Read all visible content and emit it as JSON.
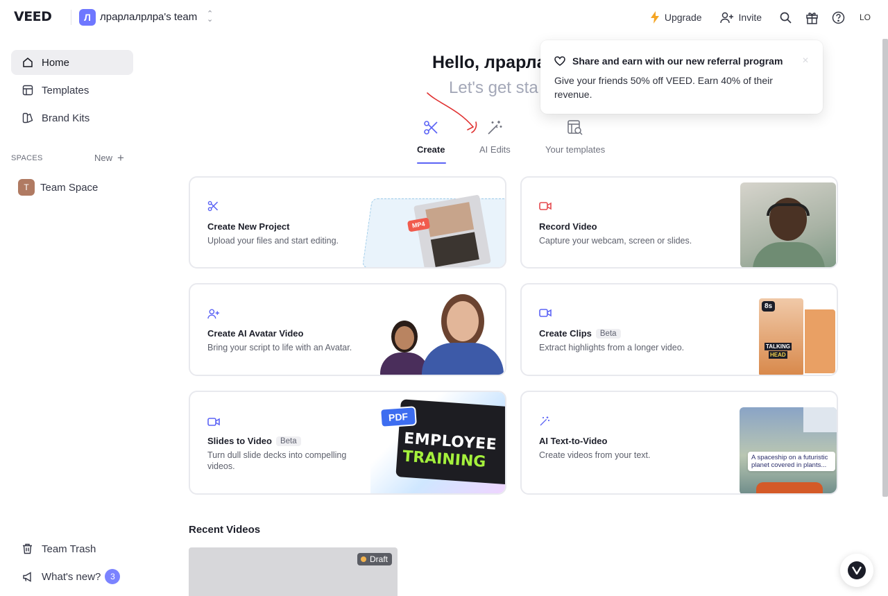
{
  "header": {
    "logo": "VEED",
    "team_avatar_letter": "Л",
    "team_name": "лрарлалрлра's team",
    "upgrade_label": "Upgrade",
    "invite_label": "Invite",
    "user_initials": "LO"
  },
  "sidebar": {
    "items": [
      {
        "label": "Home",
        "icon": "home-icon"
      },
      {
        "label": "Templates",
        "icon": "templates-icon"
      },
      {
        "label": "Brand Kits",
        "icon": "brand-kit-icon"
      }
    ],
    "spaces_label": "SPACES",
    "new_label": "New",
    "team_space": {
      "letter": "T",
      "label": "Team Space"
    },
    "trash_label": "Team Trash",
    "whats_new_label": "What's new?",
    "whats_new_count": "3"
  },
  "hero": {
    "title": "Hello, лрарла",
    "subtitle": "Let's get sta"
  },
  "tabs": [
    {
      "label": "Create",
      "icon": "scissors-icon",
      "active": true
    },
    {
      "label": "AI Edits",
      "icon": "magic-wand-icon",
      "active": false
    },
    {
      "label": "Your templates",
      "icon": "template-search-icon",
      "active": false
    }
  ],
  "cards": [
    {
      "title": "Create New Project",
      "desc": "Upload your files and start editing.",
      "icon": "scissors-icon",
      "badge": ""
    },
    {
      "title": "Record Video",
      "desc": "Capture your webcam, screen or slides.",
      "icon": "record-icon",
      "badge": ""
    },
    {
      "title": "Create AI Avatar Video",
      "desc": "Bring your script to life with an Avatar.",
      "icon": "add-person-icon",
      "badge": ""
    },
    {
      "title": "Create Clips",
      "desc": "Extract highlights from a longer video.",
      "icon": "video-camera-icon",
      "badge": "Beta"
    },
    {
      "title": "Slides to Video",
      "desc": "Turn dull slide decks into compelling videos.",
      "icon": "video-camera-icon",
      "badge": "Beta"
    },
    {
      "title": "AI Text-to-Video",
      "desc": "Create videos from your text.",
      "icon": "magic-wand-icon",
      "badge": ""
    }
  ],
  "card_art": {
    "mp4_tag": "MP4",
    "clip_duration": "8s",
    "talking_head_1": "TALKING",
    "talking_head_2": "HEAD",
    "pdf_tag": "PDF",
    "employee": "EMPLOYEE",
    "training": "TRAINING",
    "spaceship_prompt": "A spaceship on a futuristic planet covered in plants..."
  },
  "recent": {
    "title": "Recent Videos",
    "items": [
      {
        "status": "Draft"
      }
    ]
  },
  "popup": {
    "title": "Share and earn with our new referral program",
    "body": "Give your friends 50% off VEED. Earn 40% of their revenue."
  },
  "colors": {
    "accent": "#5b63f5",
    "record_red": "#e5484d",
    "upgrade_yellow": "#f5a524"
  }
}
